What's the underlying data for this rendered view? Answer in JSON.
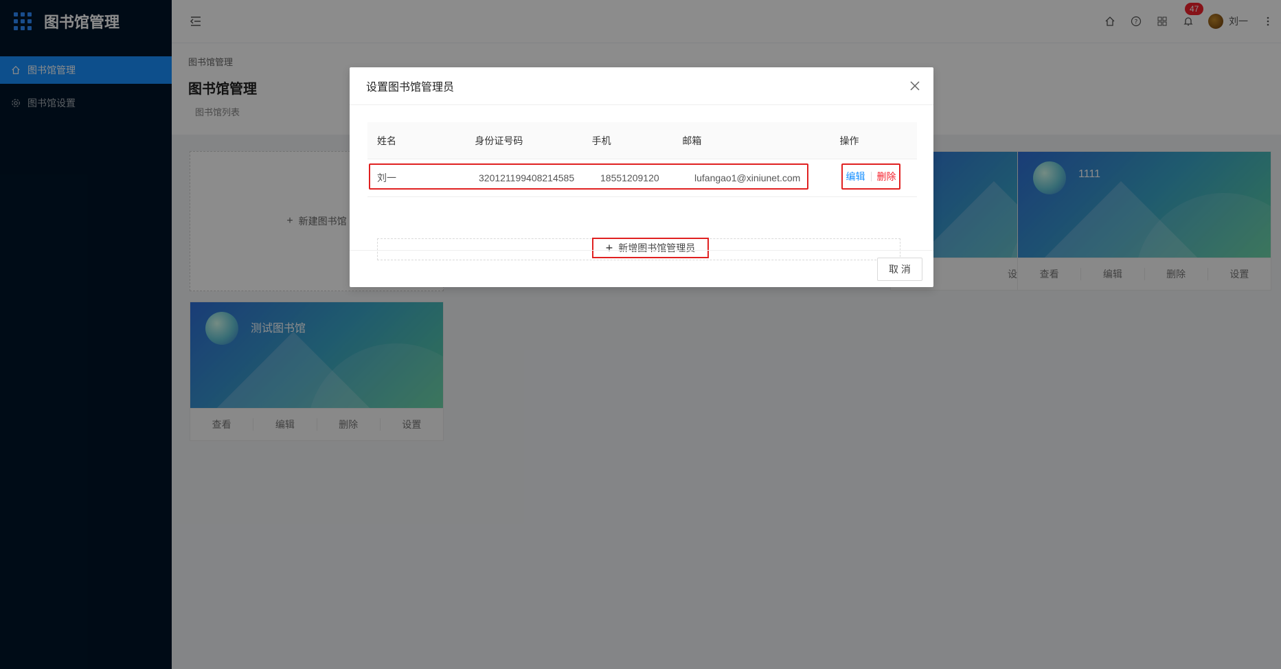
{
  "app": {
    "title": "图书馆管理"
  },
  "sidebar": {
    "items": [
      {
        "label": "图书馆管理",
        "icon": "home-icon",
        "active": true
      },
      {
        "label": "图书馆设置",
        "icon": "gear-icon",
        "active": false
      }
    ]
  },
  "header": {
    "notification_count": "47",
    "user_name": "刘一"
  },
  "page": {
    "breadcrumb": "图书馆管理",
    "title": "图书馆管理",
    "subtitle": "图书馆列表"
  },
  "cards": {
    "new_label": "新建图书馆",
    "items": [
      {
        "name": "1111"
      },
      {
        "name": "测试图书馆"
      }
    ],
    "actions": [
      "查看",
      "编辑",
      "删除",
      "设置"
    ],
    "partial_action": "设置"
  },
  "modal": {
    "title": "设置图书馆管理员",
    "columns": [
      "姓名",
      "身份证号码",
      "手机",
      "邮箱",
      "操作"
    ],
    "rows": [
      {
        "name": "刘一",
        "id_number": "320121199408214585",
        "phone": "18551209120",
        "email": "lufangao1@xiniunet.com",
        "edit": "编辑",
        "delete": "删除"
      }
    ],
    "add_label": "新增图书馆管理员",
    "cancel_label": "取 消"
  },
  "colors": {
    "sidebar_bg": "#001529",
    "accent": "#1890ff",
    "danger": "#f5222d",
    "highlight": "#e02020"
  }
}
